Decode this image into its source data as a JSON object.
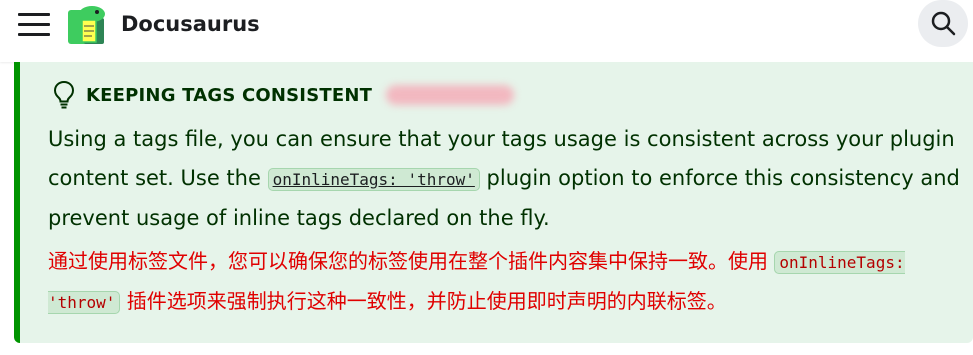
{
  "navbar": {
    "brand": "Docusaurus",
    "menu_icon": "hamburger-menu-icon",
    "logo_icon": "docusaurus-dinosaur-logo",
    "search_icon": "search-icon"
  },
  "admonition": {
    "icon": "lightbulb-icon",
    "title": "KEEPING TAGS CONSISTENT",
    "en": {
      "before": "Using a tags file, you can ensure that your tags usage is consistent across your plugin content set. Use the ",
      "code": "onInlineTags: 'throw'",
      "after": " plugin option to enforce this consistency and prevent usage of inline tags declared on the fly."
    },
    "zh": {
      "before": "通过使用标签文件，您可以确保您的标签使用在整个插件内容集中保持一致。使用 ",
      "code": "onInlineTags: 'throw'",
      "after": " 插件选项来强制执行这种一致性，并防止使用即时声明的内联标签。"
    },
    "colors": {
      "background": "#e6f4ea",
      "border": "#009400",
      "translation_text": "#e00000"
    }
  }
}
